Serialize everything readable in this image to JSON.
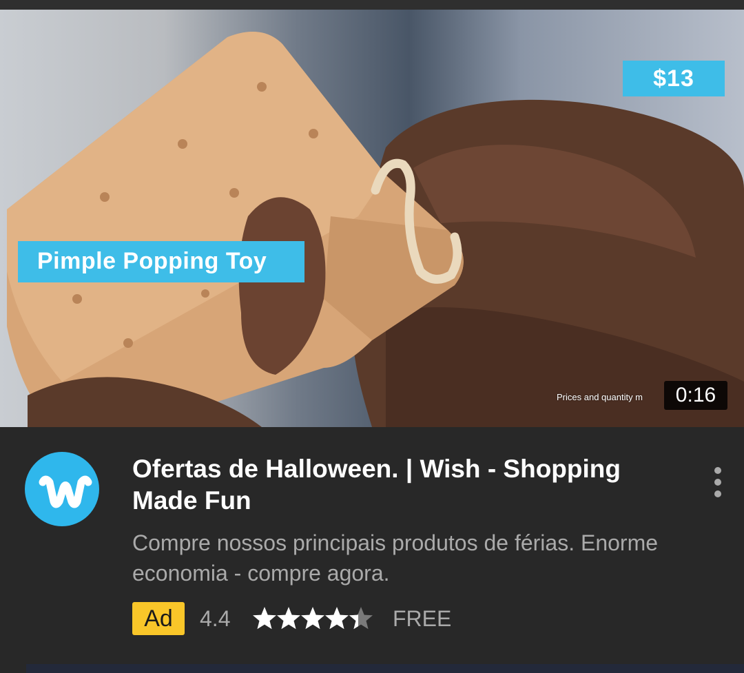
{
  "video": {
    "price": "$13",
    "product_label": "Pimple Popping Toy",
    "disclaimer": "Prices and quantity m",
    "duration": "0:16"
  },
  "ad": {
    "brand_icon": "wish-logo-icon",
    "title": "Ofertas de Halloween. | Wish - Shopping Made Fun",
    "description": "Compre nossos principais produtos de férias. Enorme economia - compre agora.",
    "badge": "Ad",
    "rating": "4.4",
    "rating_value": 4.4,
    "rating_max": 5,
    "price_label": "FREE",
    "menu_icon": "more-vert-icon"
  },
  "colors": {
    "accent_blue": "#3ebde8",
    "badge_yellow": "#f9c629",
    "background": "#282828"
  }
}
